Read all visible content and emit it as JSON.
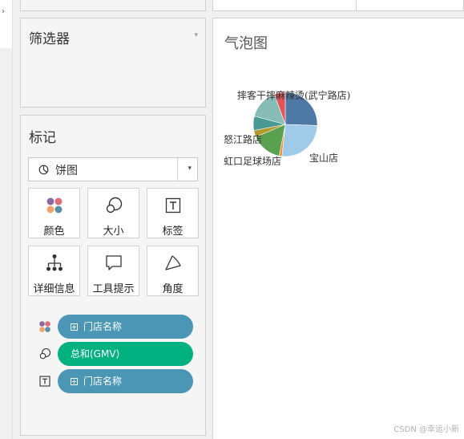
{
  "left_strip": {
    "chevron": "›"
  },
  "filters_card": {
    "title": "筛选器",
    "caret": "▾"
  },
  "marks_card": {
    "title": "标记",
    "mark_type": {
      "icon": "pie-chart-icon",
      "label": "饼图",
      "dropdown": "▾"
    },
    "buttons": [
      {
        "label": "颜色",
        "icon": "color-dots-icon"
      },
      {
        "label": "大小",
        "icon": "size-circles-icon"
      },
      {
        "label": "标签",
        "icon": "label-t-icon"
      },
      {
        "label": "详细信息",
        "icon": "detail-tree-icon"
      },
      {
        "label": "工具提示",
        "icon": "tooltip-bubble-icon"
      },
      {
        "label": "角度",
        "icon": "angle-icon"
      }
    ],
    "pills": [
      {
        "icon": "color-dots-icon",
        "label": "门店名称",
        "has_plus": true,
        "color": "#4a96b4"
      },
      {
        "icon": "size-circles-icon",
        "label": "总和(GMV)",
        "has_plus": false,
        "color": "#00b180"
      },
      {
        "icon": "label-t-icon",
        "label": "门店名称",
        "has_plus": true,
        "color": "#4a96b4"
      }
    ]
  },
  "sheet": {
    "title": "气泡图",
    "pie_labels": [
      "摔客干摔麻辣烫(武宁路店)",
      "怒江路店",
      "虹口足球场店",
      "宝山店"
    ],
    "slice_colors": [
      "#4e79a7",
      "#a0cbe8",
      "#f28e2b",
      "#59a14f",
      "#b6992d",
      "#499894",
      "#86bcb6",
      "#e15759"
    ]
  },
  "watermark": "CSDN @幸运小新"
}
